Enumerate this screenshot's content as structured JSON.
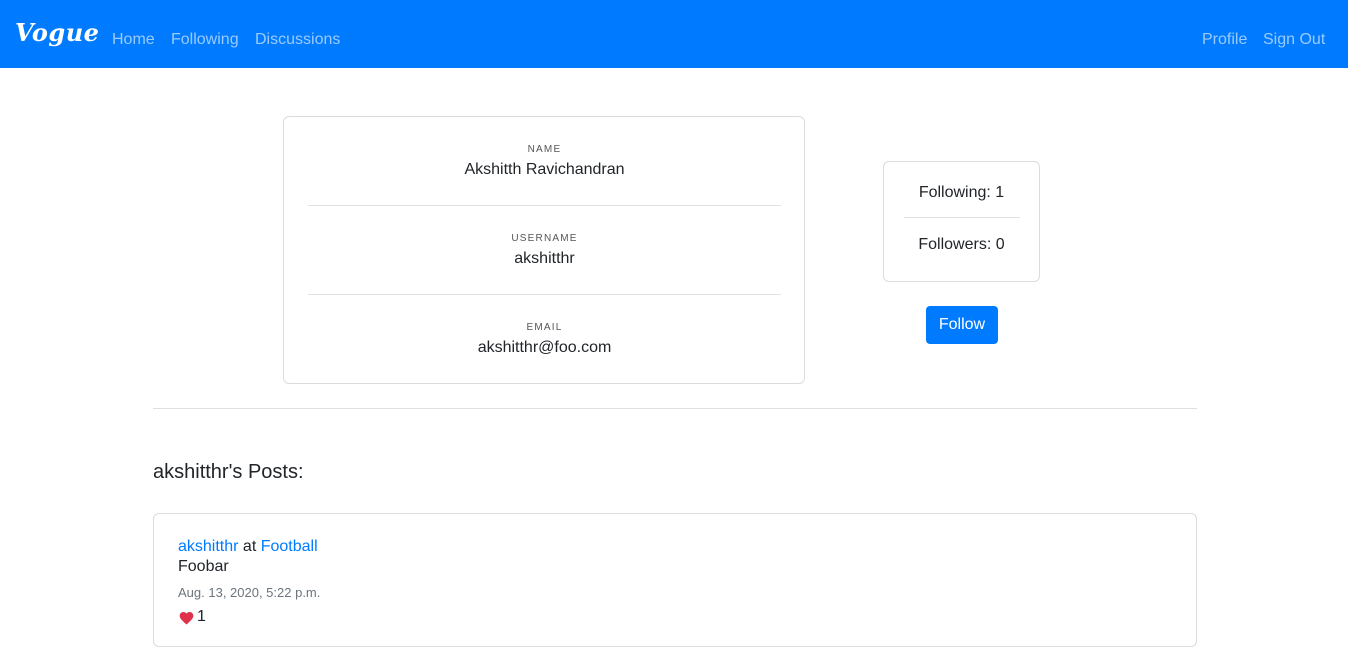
{
  "nav": {
    "brand": "Vogue",
    "home": "Home",
    "following": "Following",
    "discussions": "Discussions",
    "profile": "Profile",
    "sign_out": "Sign Out",
    "bg_color": "#007bff"
  },
  "profile": {
    "name_label": "NAME",
    "name": "Akshitth Ravichandran",
    "username_label": "USERNAME",
    "username": "akshitthr",
    "email_label": "EMAIL",
    "email": "akshitthr@foo.com"
  },
  "stats": {
    "following": "Following: 1",
    "followers": "Followers: 0"
  },
  "follow_button": "Follow",
  "posts": {
    "heading": "akshitthr's Posts:",
    "items": [
      {
        "author": "akshitthr",
        "at": "at",
        "group": "Football",
        "body": "Foobar",
        "timestamp": "Aug. 13, 2020, 5:22 p.m.",
        "likes": "1",
        "like_icon": "heart-icon",
        "like_color": "#e0314b"
      }
    ]
  }
}
